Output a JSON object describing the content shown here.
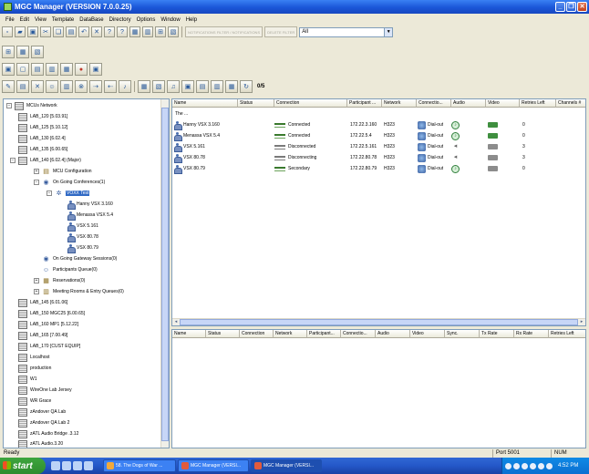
{
  "window": {
    "title": "MGC Manager (VERSION 7.0.0.25)"
  },
  "menu": [
    "File",
    "Edit",
    "View",
    "Template",
    "DataBase",
    "Directory",
    "Options",
    "Window",
    "Help"
  ],
  "toolbar": {
    "filter_btn_1": "NOTIFICATIONS FILTER / NOTIFICATIONS",
    "filter_btn_2": "DELETE FILTER",
    "filter_value": "All",
    "count_label": "0/5"
  },
  "tree": {
    "root": "MCUs Network",
    "mcus_top": [
      "LAB_120 [5.03.91]",
      "LAB_125 [5.10.12]",
      "LAB_130 [6.02.4]",
      "LAB_135 [6.00.65]",
      "LAB_140 [6.02.4] (Major)"
    ],
    "mcu_configuration": "MCU Configuration",
    "ongoing_conferences": "On Going Conferences(1)",
    "conference": "VOXX Test",
    "participants": [
      "Hanny VSX 3.160",
      "Menassa VSX 5.4",
      "VSX 5.161",
      "VSX 80.78",
      "VSX 80.79"
    ],
    "ongoing_gateway": "On Going Gateway Sessions(0)",
    "participants_queue": "Participants Queue(0)",
    "reservations": "Reservations(0)",
    "meeting_rooms": "Meeting Rooms & Entry Queues(0)",
    "mcus_bottom": [
      "LAB_145 [6.01.06]",
      "LAB_150 MGC25 [6.00.65]",
      "LAB_160 MP1 [5.12.22]",
      "LAB_165 [7.00.49]",
      "LAB_170 [CUST EQUIP]",
      "Localhost",
      "production",
      "W1",
      "WireOne Lab Jersey",
      "WR Grace",
      "zAndover QA Lab",
      "zAndover QA Lab 2",
      "zATL Audio Bridge .3.12",
      "zATL Audio.3.20"
    ]
  },
  "participants_table": {
    "columns": [
      "Name",
      "Status",
      "Connection",
      "Participant ...",
      "Network",
      "Connectio...",
      "Audio",
      "Video",
      "Retries Left",
      "Channels #"
    ],
    "first_row": "The ...",
    "rows": [
      {
        "name": "Hanny VSX 3.160",
        "connection": "Connected",
        "participant": "172.22.3.160",
        "network": "H323",
        "conn_type": "Dial-out",
        "retries": "0"
      },
      {
        "name": "Menassa VSX 5.4",
        "connection": "Connected",
        "participant": "172.22.5.4",
        "network": "H323",
        "conn_type": "Dial-out",
        "retries": "0"
      },
      {
        "name": "VSX 5.161",
        "connection": "Disconnected",
        "participant": "172.22.5.161",
        "network": "H323",
        "conn_type": "Dial-out",
        "retries": "3"
      },
      {
        "name": "VSX 80.78",
        "connection": "Disconnecting",
        "participant": "172.22.80.78",
        "network": "H323",
        "conn_type": "Dial-out",
        "retries": "3"
      },
      {
        "name": "VSX 80.79",
        "connection": "Secondary",
        "participant": "172.22.80.79",
        "network": "H323",
        "conn_type": "Dial-out",
        "retries": "0"
      }
    ]
  },
  "bottom_table": {
    "columns": [
      "Name",
      "Status",
      "Connection",
      "Network",
      "Participant...",
      "Connectio...",
      "Audio",
      "Video",
      "Sync.",
      "Tx Rate",
      "Rx Rate",
      "Retries Left"
    ]
  },
  "status_bar": {
    "text": "Ready",
    "port": "Port 5001",
    "num": "NUM"
  },
  "taskbar": {
    "start": "start",
    "tasks": [
      "58. The Dogs of War ...",
      "MGC Manager (VERSI...",
      "MGC Manager (VERSI..."
    ],
    "clock": "4:52 PM"
  },
  "colors": {
    "accent": "#316ac5",
    "titlebar": "#1a56d8",
    "taskbar": "#2457c8",
    "start": "#2e8c2e"
  }
}
